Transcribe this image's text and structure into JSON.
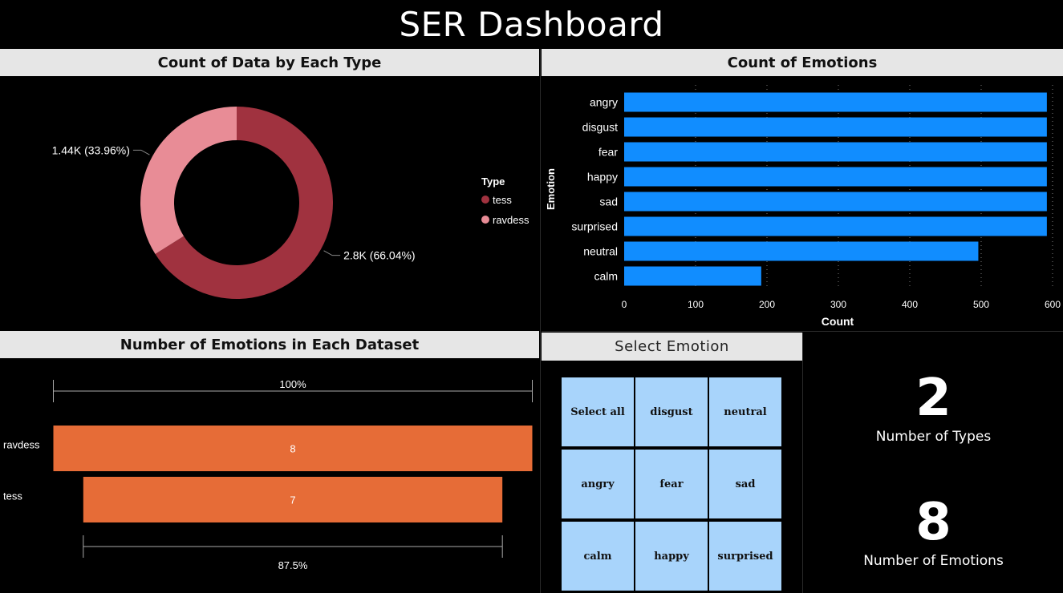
{
  "dashboard_title": "SER Dashboard",
  "colors": {
    "donut_tess": "#a0323f",
    "donut_ravdess": "#e88c96",
    "emotion_bar": "#118dff",
    "funnel_bar": "#e66c37",
    "slicer_tile": "#a8d4fb",
    "header_bg": "#e6e6e6"
  },
  "type_panel": {
    "title": "Count of Data by Each Type",
    "legend_title": "Type",
    "legend": [
      {
        "name": "tess",
        "icon": "circle-marker-icon"
      },
      {
        "name": "ravdess",
        "icon": "circle-marker-icon"
      }
    ]
  },
  "emotions_panel": {
    "title": "Count of Emotions"
  },
  "dataset_panel": {
    "title": "Number of Emotions in Each Dataset"
  },
  "slicer": {
    "title": "Select Emotion",
    "options": [
      "Select all",
      "disgust",
      "neutral",
      "angry",
      "fear",
      "sad",
      "calm",
      "happy",
      "surprised"
    ]
  },
  "kpis": {
    "types_value": "2",
    "types_label": "Number of Types",
    "emotions_value": "8",
    "emotions_label": "Number of Emotions"
  },
  "chart_data": [
    {
      "type": "pie",
      "title": "Count of Data by Each Type",
      "donut": true,
      "legend_title": "Type",
      "legend_position": "right",
      "series": [
        {
          "name": "tess",
          "value": 2800,
          "percent": 66.04,
          "label": "2.8K (66.04%)"
        },
        {
          "name": "ravdess",
          "value": 1440,
          "percent": 33.96,
          "label": "1.44K (33.96%)"
        }
      ]
    },
    {
      "type": "bar",
      "orientation": "horizontal",
      "title": "Count of Emotions",
      "categories": [
        "angry",
        "disgust",
        "fear",
        "happy",
        "sad",
        "surprised",
        "neutral",
        "calm"
      ],
      "values": [
        592,
        592,
        592,
        592,
        592,
        592,
        496,
        192
      ],
      "xlabel": "Count",
      "ylabel": "Emotion",
      "xlim": [
        0,
        600
      ],
      "xticks": [
        0,
        100,
        200,
        300,
        400,
        500,
        600
      ],
      "grid": "vertical-dotted"
    },
    {
      "type": "bar",
      "subtype": "funnel",
      "title": "Number of Emotions in Each Dataset",
      "categories": [
        "ravdess",
        "tess"
      ],
      "values": [
        8,
        7
      ],
      "top_percent_label": "100%",
      "bottom_percent_label": "87.5%"
    }
  ]
}
